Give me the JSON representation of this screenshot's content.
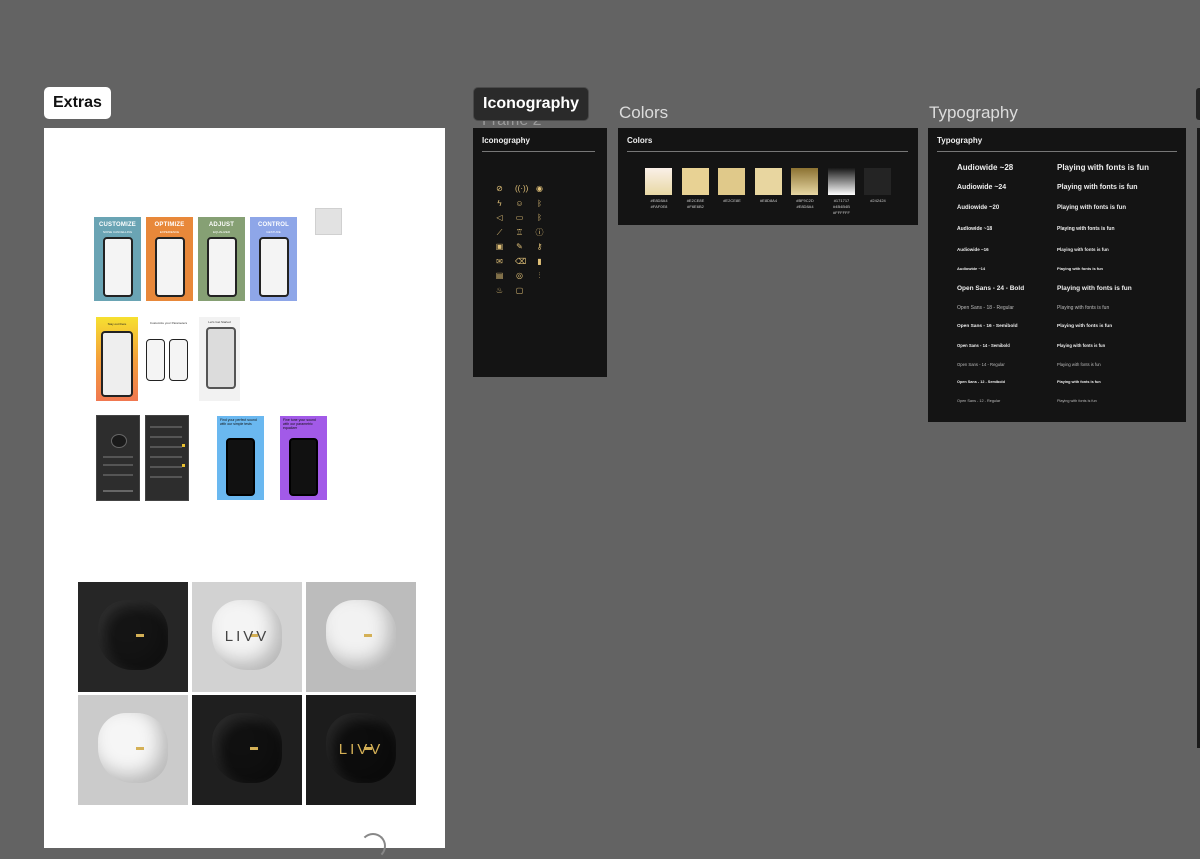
{
  "frames": {
    "extras": {
      "label": "Extras"
    },
    "iconography": {
      "label": "Iconography",
      "ghost_label": "Frame 2",
      "panel_title": "Iconography"
    },
    "colors": {
      "label": "Colors",
      "panel_title": "Colors"
    },
    "typography": {
      "label": "Typography",
      "panel_title": "Typography"
    }
  },
  "promo_cards": [
    {
      "title": "CUSTOMIZE",
      "subtitle": "NOISE CANCELLING",
      "color": "#6aa4b4"
    },
    {
      "title": "OPTIMIZE",
      "subtitle": "EXPERIENCE",
      "color": "#e8883a"
    },
    {
      "title": "ADJUST",
      "subtitle": "EQUALIZER",
      "color": "#86a074"
    },
    {
      "title": "CONTROL",
      "subtitle": "GESTURE",
      "color": "#8ea6e8"
    }
  ],
  "quiz_cards": [
    {
      "text": "Find your perfect sound with our simple tests",
      "color": "#6ab8f0"
    },
    {
      "text": "Fine tune your sound with our parametric equalizer",
      "color": "#a25ae8"
    }
  ],
  "onboarding": [
    {
      "text": "Stay out there"
    },
    {
      "text": "Customize your Parameters"
    },
    {
      "text": "Let's Get Started"
    }
  ],
  "product_tiles": [
    {
      "bg": "#262626",
      "product": "#141414",
      "label": ""
    },
    {
      "bg": "#d2d2d2",
      "product": "#f4f4f4",
      "label": "LIVV"
    },
    {
      "bg": "#bcbcbc",
      "product": "#f2f2f2",
      "label": ""
    },
    {
      "bg": "#cbcbcb",
      "product": "#f6f6f6",
      "label": ""
    },
    {
      "bg": "#1f1f1f",
      "product": "#101010",
      "label": ""
    },
    {
      "bg": "#1c1c1c",
      "product": "#0d0d0d",
      "label": "LIVV"
    }
  ],
  "color_swatches": [
    {
      "hex": "#E8D8A4",
      "hex2": "#FAF0E8",
      "fill": "linear-gradient(180deg,#faf0e8,#e8d8a4)"
    },
    {
      "hex": "#E2CE8E",
      "hex2": "#F6E6B2",
      "fill": "#e8d294"
    },
    {
      "hex": "#E2CE8E",
      "hex2": "",
      "fill": "#e0c98a"
    },
    {
      "hex": "#E8D8A4",
      "hex2": "",
      "fill": "#e8d6a0"
    },
    {
      "hex": "#BF9C2D",
      "hex2": "#E8D8A4",
      "fill": "linear-gradient(180deg,#8c7232,#e8d8a4)"
    },
    {
      "hex": "#171717",
      "hex2": "#4B4B4B",
      "hex3": "#FFFFFF",
      "fill": "linear-gradient(180deg,#171717,#ffffff)"
    },
    {
      "hex": "#242424",
      "hex2": "",
      "fill": "#242424"
    }
  ],
  "typography": {
    "rows": [
      {
        "left": "Audiowide ~28",
        "right": "Playing with fonts is fun",
        "size": 8,
        "bold": true
      },
      {
        "left": "Audiowide ~24",
        "right": "Playing with fonts is fun",
        "size": 7,
        "bold": true
      },
      {
        "left": "Audiowide ~20",
        "right": "Playing with fonts is fun",
        "size": 6,
        "bold": true
      },
      {
        "left": "Audiowide ~18",
        "right": "Playing with fonts is fun",
        "size": 5,
        "bold": true
      },
      {
        "left": "Audiowide ~16",
        "right": "Playing with fonts is fun",
        "size": 4.5,
        "bold": true
      },
      {
        "left": "Audiowide ~14",
        "right": "Playing with fonts is fun",
        "size": 4,
        "bold": true
      },
      {
        "left": "Open Sans - 24 - Bold",
        "right": "Playing with fonts is fun",
        "size": 6.5,
        "bold": true
      },
      {
        "left": "Open Sans - 18 - Regular",
        "right": "Playing with fonts is fun",
        "size": 5,
        "bold": false
      },
      {
        "left": "Open Sans - 16 - Semibold",
        "right": "Playing with fonts is fun",
        "size": 4.8,
        "bold": true
      },
      {
        "left": "Open Sans - 14 - Semibold",
        "right": "Playing with fonts is fun",
        "size": 4.2,
        "bold": true
      },
      {
        "left": "Open Sans - 14 - Regular",
        "right": "Playing with fonts is fun",
        "size": 4.2,
        "bold": false
      },
      {
        "left": "Open Sans - 12 - Semibold",
        "right": "Playing with fonts is fun",
        "size": 3.8,
        "bold": true
      },
      {
        "left": "Open Sans - 12 - Regular",
        "right": "Playing with fonts is fun",
        "size": 3.8,
        "bold": false
      }
    ]
  },
  "icons": [
    {
      "name": "mute-icon",
      "glyph": "⊘"
    },
    {
      "name": "broadcast-icon",
      "glyph": "((·))"
    },
    {
      "name": "user-circle-icon",
      "glyph": "◉"
    },
    {
      "name": "lightning-icon",
      "glyph": "ϟ"
    },
    {
      "name": "user-icon",
      "glyph": "☺"
    },
    {
      "name": "bluetooth-icon",
      "glyph": "ᛒ"
    },
    {
      "name": "volume-icon",
      "glyph": "◁"
    },
    {
      "name": "calendar-icon",
      "glyph": "▭"
    },
    {
      "name": "bluetooth-wave-icon",
      "glyph": "ᛒ"
    },
    {
      "name": "wand-icon",
      "glyph": "⟋"
    },
    {
      "name": "trophy-icon",
      "glyph": "♖"
    },
    {
      "name": "info-icon",
      "glyph": "ⓘ"
    },
    {
      "name": "image-icon",
      "glyph": "▣"
    },
    {
      "name": "pencil-icon",
      "glyph": "✎"
    },
    {
      "name": "key-icon",
      "glyph": "⚷"
    },
    {
      "name": "mail-icon",
      "glyph": "✉"
    },
    {
      "name": "trash-icon",
      "glyph": "⌫"
    },
    {
      "name": "battery-icon",
      "glyph": "▮"
    },
    {
      "name": "card-icon",
      "glyph": "▤"
    },
    {
      "name": "eye-icon",
      "glyph": "◎"
    },
    {
      "name": "equalizer-icon",
      "glyph": "⫶"
    },
    {
      "name": "flame-icon",
      "glyph": "♨"
    },
    {
      "name": "bag-icon",
      "glyph": "▢"
    }
  ]
}
